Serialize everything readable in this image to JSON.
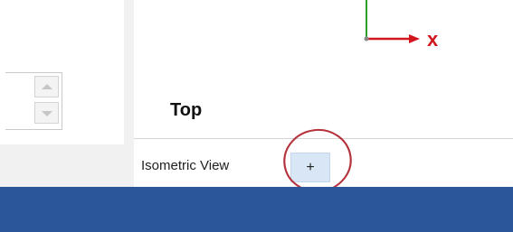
{
  "viewport": {
    "axis_label_x": "x",
    "view_name": "Top",
    "colors": {
      "x_axis": "#d1171e",
      "y_axis": "#2aa02a"
    }
  },
  "tabs": {
    "items": [
      {
        "label": "Isometric View"
      }
    ],
    "add_label": "+"
  },
  "status_bar": {
    "color": "#2b579a"
  },
  "annotation": {
    "color": "#b5323a"
  }
}
